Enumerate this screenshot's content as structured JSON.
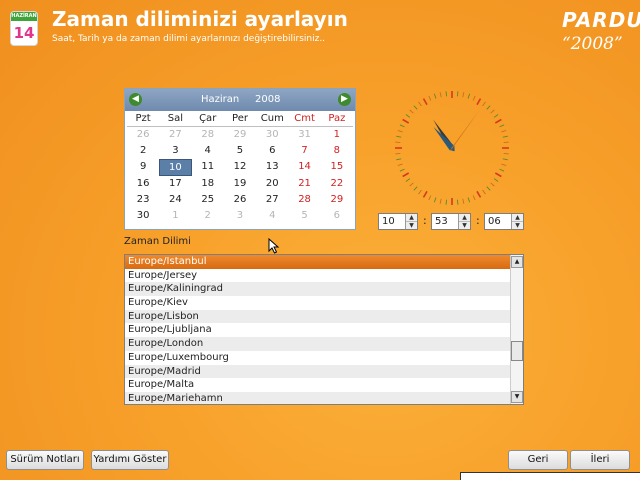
{
  "header": {
    "icon_month": "HAZİRAN",
    "icon_day": "14",
    "title": "Zaman diliminizi ayarlayın",
    "subtitle": "Saat, Tarih ya da zaman dilimi ayarlarınızı değiştirebilirsiniz..",
    "brand": "PARDUS",
    "brand_year": "“2008”"
  },
  "calendar": {
    "month": "Haziran",
    "year": "2008",
    "prev_icon": "arrow-left-icon",
    "next_icon": "arrow-right-icon",
    "day_names": [
      "Pzt",
      "Sal",
      "Çar",
      "Per",
      "Cum",
      "Cmt",
      "Paz"
    ],
    "weeks": [
      [
        "26",
        "27",
        "28",
        "29",
        "30",
        "31",
        "1"
      ],
      [
        "2",
        "3",
        "4",
        "5",
        "6",
        "7",
        "8"
      ],
      [
        "9",
        "10",
        "11",
        "12",
        "13",
        "14",
        "15"
      ],
      [
        "16",
        "17",
        "18",
        "19",
        "20",
        "21",
        "22"
      ],
      [
        "23",
        "24",
        "25",
        "26",
        "27",
        "28",
        "29"
      ],
      [
        "30",
        "1",
        "2",
        "3",
        "4",
        "5",
        "6"
      ]
    ],
    "selected_day": "10"
  },
  "clock": {
    "hour": 10,
    "minute": 53,
    "second": 6
  },
  "time": {
    "hour": "10",
    "minute": "53",
    "second": "06",
    "separator": ":"
  },
  "timezone": {
    "label": "Zaman Dilimi",
    "items": [
      "Europe/Istanbul",
      "Europe/Jersey",
      "Europe/Kaliningrad",
      "Europe/Kiev",
      "Europe/Lisbon",
      "Europe/Ljubljana",
      "Europe/London",
      "Europe/Luxembourg",
      "Europe/Madrid",
      "Europe/Malta",
      "Europe/Mariehamn"
    ],
    "selected": "Europe/Istanbul"
  },
  "buttons": {
    "release_notes": "Sürüm Notları",
    "show_help": "Yardımı Göster",
    "back": "Geri",
    "next": "İleri"
  },
  "colors": {
    "background": "#f7a02a",
    "selection": "#e07818",
    "calendar_header": "#7f98bb",
    "weekend": "#d02222"
  }
}
